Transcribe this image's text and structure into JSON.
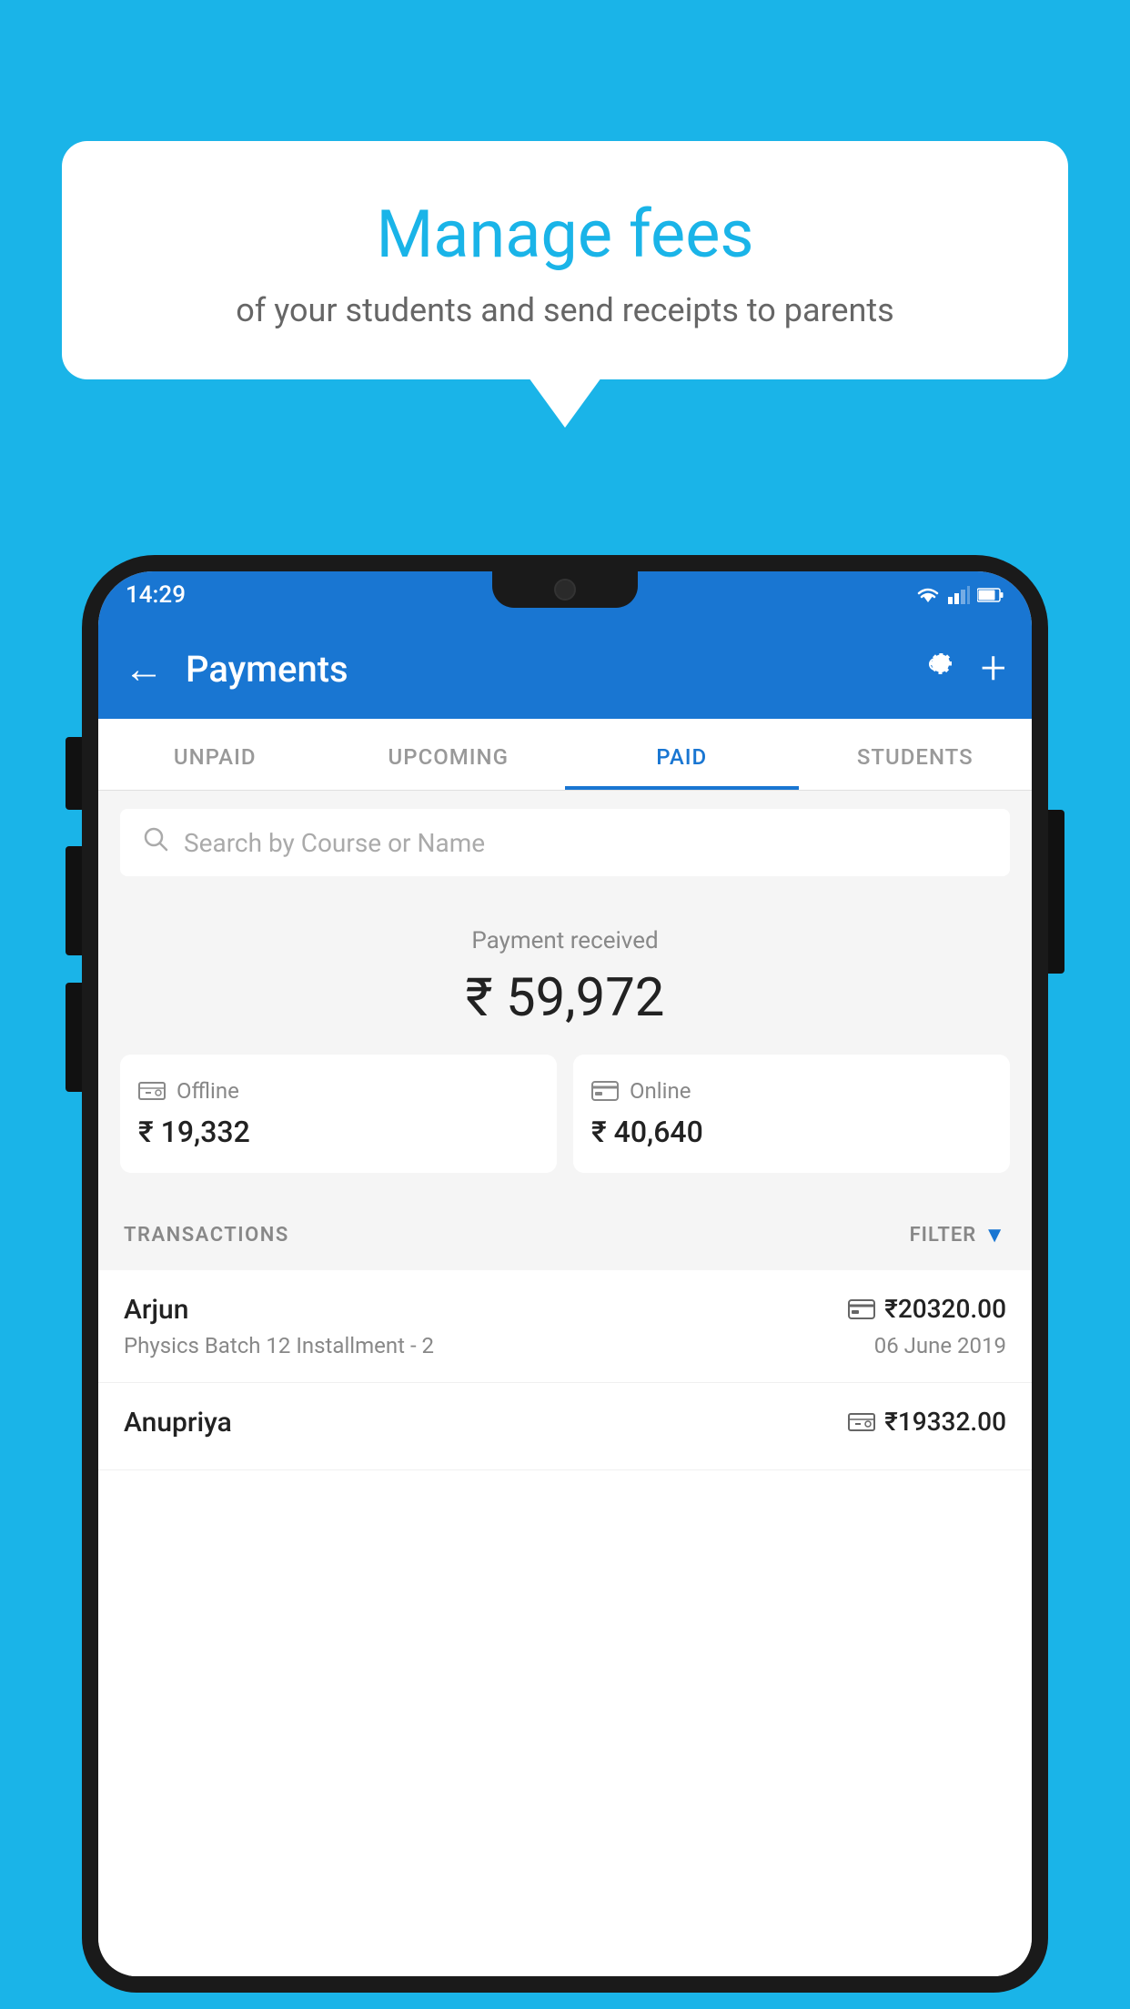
{
  "background_color": "#1ab4e8",
  "speech_bubble": {
    "title": "Manage fees",
    "subtitle": "of your students and send receipts to parents"
  },
  "status_bar": {
    "time": "14:29"
  },
  "app_bar": {
    "title": "Payments",
    "back_label": "←",
    "settings_icon": "gear-icon",
    "add_icon": "plus-icon"
  },
  "tabs": [
    {
      "label": "UNPAID",
      "active": false
    },
    {
      "label": "UPCOMING",
      "active": false
    },
    {
      "label": "PAID",
      "active": true
    },
    {
      "label": "STUDENTS",
      "active": false
    }
  ],
  "search": {
    "placeholder": "Search by Course or Name"
  },
  "payment_summary": {
    "label": "Payment received",
    "amount": "₹ 59,972",
    "offline": {
      "label": "Offline",
      "amount": "₹ 19,332"
    },
    "online": {
      "label": "Online",
      "amount": "₹ 40,640"
    }
  },
  "transactions_section": {
    "label": "TRANSACTIONS",
    "filter_label": "FILTER"
  },
  "transactions": [
    {
      "name": "Arjun",
      "course": "Physics Batch 12 Installment - 2",
      "amount": "₹20320.00",
      "date": "06 June 2019",
      "mode": "online"
    },
    {
      "name": "Anupriya",
      "course": "",
      "amount": "₹19332.00",
      "date": "",
      "mode": "offline"
    }
  ]
}
